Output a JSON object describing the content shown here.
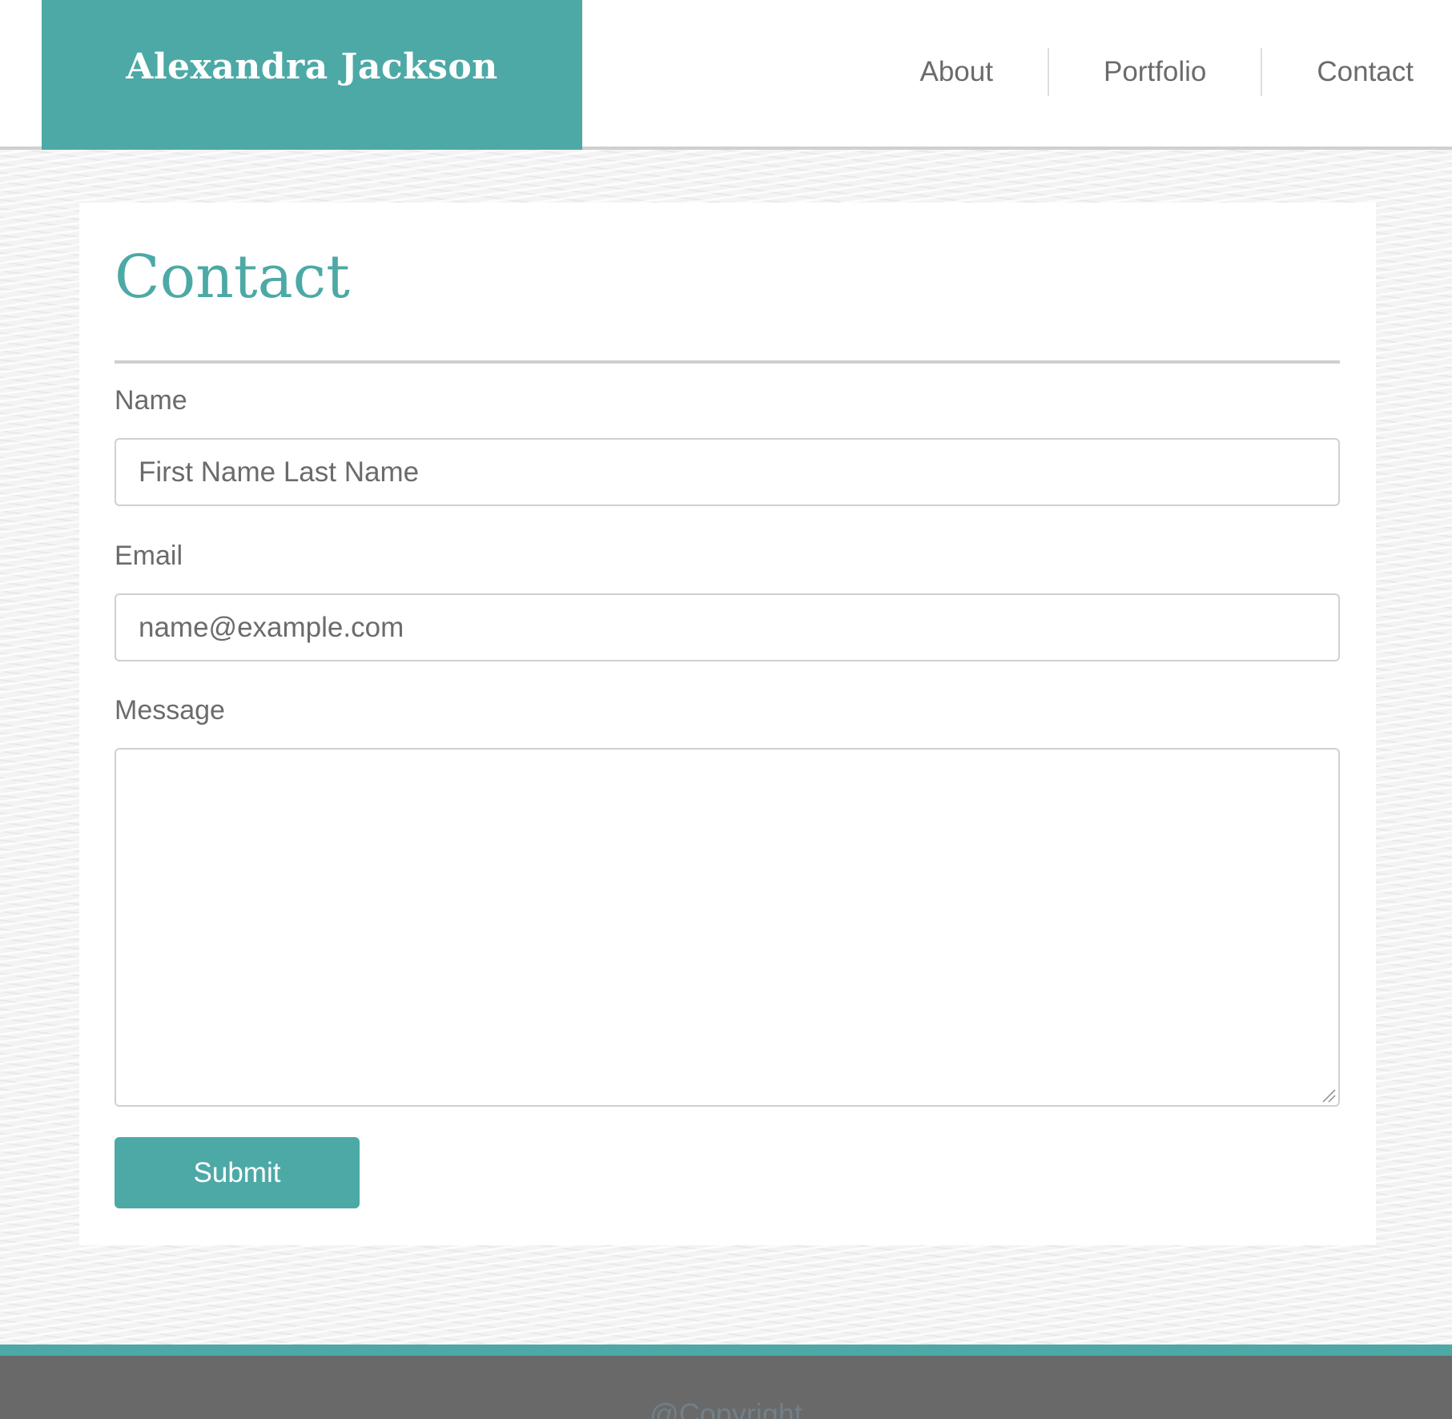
{
  "header": {
    "brand_name": "Alexandra Jackson",
    "nav": [
      {
        "label": "About"
      },
      {
        "label": "Portfolio"
      },
      {
        "label": "Contact"
      }
    ]
  },
  "main": {
    "title": "Contact",
    "form": {
      "name": {
        "label": "Name",
        "placeholder": "First Name Last Name",
        "value": ""
      },
      "email": {
        "label": "Email",
        "placeholder": "name@example.com",
        "value": ""
      },
      "message": {
        "label": "Message",
        "value": ""
      },
      "submit_label": "Submit"
    }
  },
  "footer": {
    "text": "@Copyright"
  },
  "colors": {
    "accent": "#4ca9a6",
    "footer_bg": "#696969",
    "text_gray": "#6b6b6b",
    "border": "#d0d0d0",
    "background": "#f3f3f3"
  },
  "icons": {
    "resize_handle": "resize-grip-icon"
  }
}
